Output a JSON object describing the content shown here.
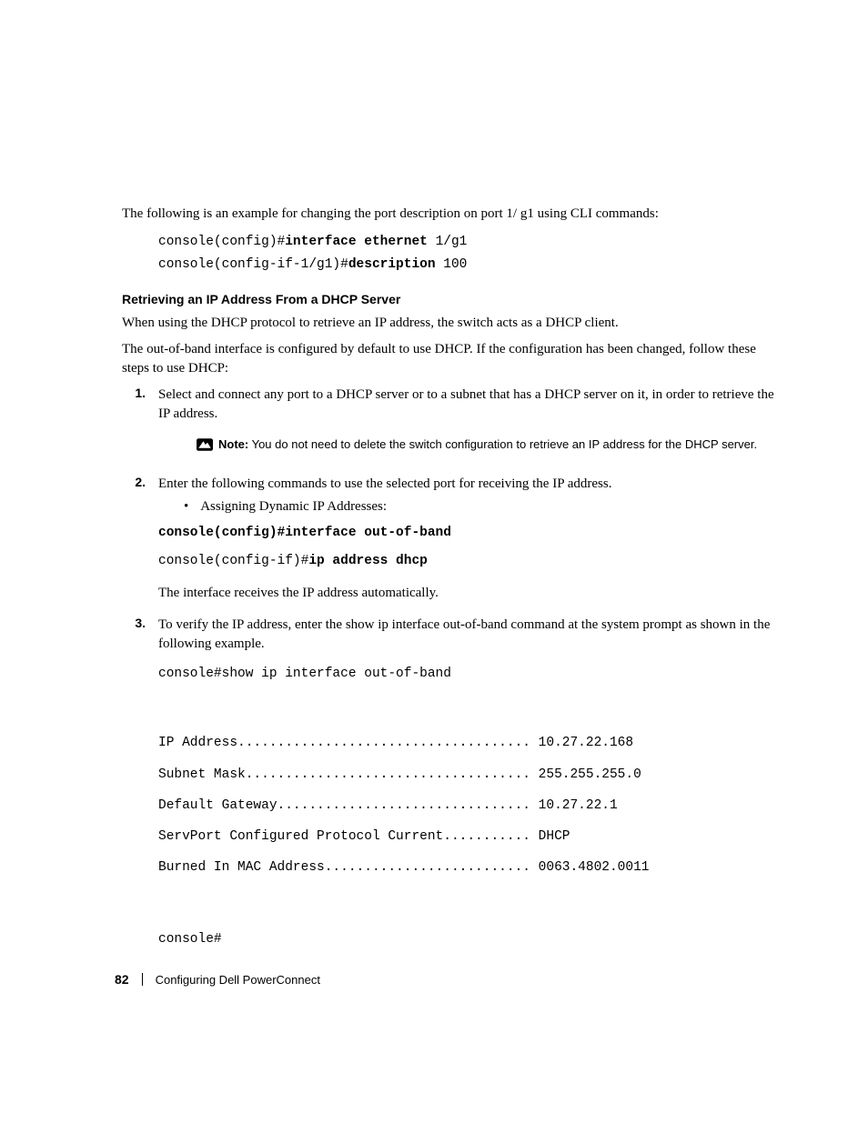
{
  "intro": "The following is an example for changing the port description on port 1/ g1 using CLI commands:",
  "example1": {
    "line1_prefix": "console(config)#",
    "line1_cmd": "interface ethernet",
    "line1_suffix": " 1/g1",
    "line2_prefix": "console(config-if-1/g1)#",
    "line2_cmd": "description",
    "line2_suffix": " 100"
  },
  "heading": "Retrieving an IP Address From a DHCP Server",
  "para1": "When using the DHCP protocol to retrieve an IP address, the switch acts as a DHCP client.",
  "para2": "The out-of-band interface is configured by default to use DHCP. If the configuration has been changed, follow these steps to use DHCP:",
  "steps": {
    "s1_num": "1.",
    "s1_text": "Select and connect any port to a DHCP server or to a subnet that has a DHCP server on it, in order to retrieve the IP address.",
    "note_label": "Note:",
    "note_text": " You do not need to delete the switch configuration to retrieve an IP address for the DHCP server.",
    "s2_num": "2.",
    "s2_text": "Enter the following commands to use the selected port for receiving the IP address.",
    "s2_bullet": "Assigning Dynamic IP Addresses:",
    "s2_code1": "console(config)#interface out-of-band",
    "s2_code2_prefix": "console(config-if)#",
    "s2_code2_cmd": "ip address dhcp",
    "s2_after": "The interface receives the IP address automatically.",
    "s3_num": "3.",
    "s3_text": "To verify the IP address, enter the show ip interface out-of-band command at the system prompt as shown in the following example.",
    "s3_code1": "console#show ip interface out-of-band",
    "s3_out1": "IP Address..................................... 10.27.22.168",
    "s3_out2": "Subnet Mask.................................... 255.255.255.0",
    "s3_out3": "Default Gateway................................ 10.27.22.1",
    "s3_out4": "ServPort Configured Protocol Current........... DHCP",
    "s3_out5": "Burned In MAC Address.......................... 0063.4802.0011",
    "s3_prompt": "console#"
  },
  "footer": {
    "pagenum": "82",
    "title": "Configuring Dell PowerConnect"
  }
}
